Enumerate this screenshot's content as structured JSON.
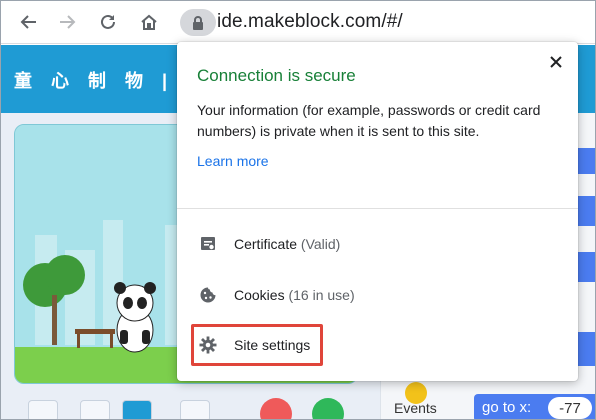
{
  "browser": {
    "url": "ide.makeblock.com/#/",
    "icons": {
      "back": "back-arrow-icon",
      "forward": "forward-arrow-icon",
      "reload": "reload-icon",
      "home": "home-icon",
      "lock": "lock-icon"
    }
  },
  "app": {
    "title": "童 心 制 物 | 慧編",
    "events_label": "Events",
    "goto_label": "go to x:",
    "goto_value": "-77"
  },
  "popup": {
    "title": "Connection is secure",
    "description": "Your information (for example, passwords or credit card numbers) is private when it is sent to this site.",
    "learn_more": "Learn more",
    "rows": [
      {
        "label": "Certificate",
        "sublabel": "(Valid)",
        "icon": "certificate-icon"
      },
      {
        "label": "Cookies",
        "sublabel": "(16 in use)",
        "icon": "cookie-icon"
      },
      {
        "label": "Site settings",
        "sublabel": "",
        "icon": "gear-icon"
      }
    ]
  },
  "colors": {
    "secure_green": "#188038",
    "link_blue": "#1a73e8",
    "highlight_red": "#e0453a",
    "app_header_blue": "#1f9bd4"
  }
}
